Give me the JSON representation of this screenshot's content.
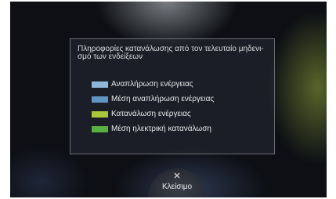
{
  "panel": {
    "title": "Πληροφορίες κατανάλωσης από τον τελευταίο μηδενι-σμό των ενδείξεων",
    "legend": [
      {
        "label": "Αναπλήρωση ενέργειας",
        "color": "#8fb8d8"
      },
      {
        "label": "Μέση αναπλήρωση ενέργειας",
        "color": "#5f96c4"
      },
      {
        "label": "Κατανάλωση ενέργειας",
        "color": "#a8c83a"
      },
      {
        "label": "Μέση ηλεκτρική κατανάλωση",
        "color": "#58b040"
      }
    ]
  },
  "footer": {
    "close_label": "Κλείσιμο",
    "close_icon": "close-icon"
  }
}
